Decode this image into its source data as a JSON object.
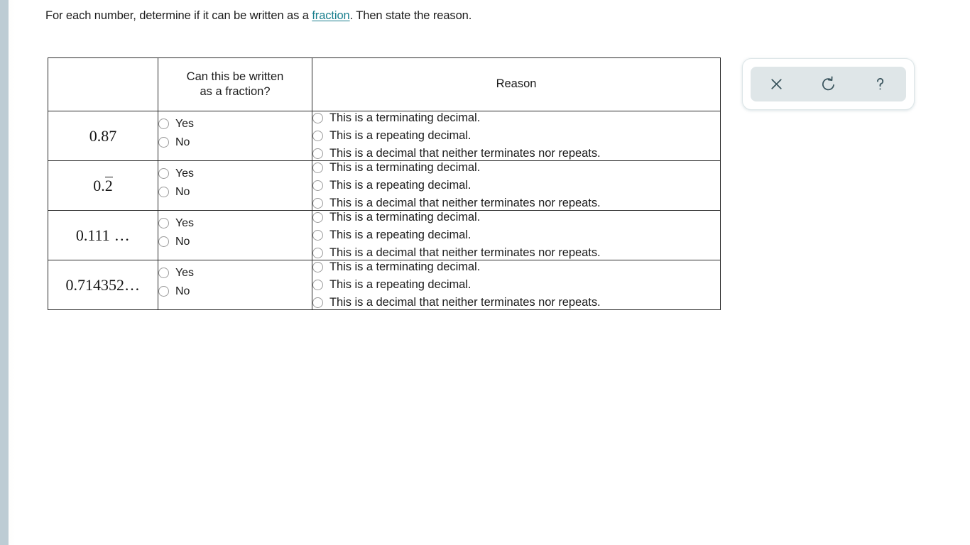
{
  "page": {
    "background_color": "#ffffff",
    "left_strip_color": "#bdccd4",
    "link_color": "#1a7f8e",
    "text_color": "#1c1c1c"
  },
  "prompt": {
    "before_link": "For each number, determine if it can be written as a ",
    "link_text": "fraction",
    "after_link": ". Then state the reason."
  },
  "table": {
    "headers": {
      "number_column": "",
      "fraction_column_line1": "Can this be written",
      "fraction_column_line2": "as a fraction?",
      "reason_column": "Reason"
    },
    "yesno_options": [
      "Yes",
      "No"
    ],
    "reason_options": [
      "This is a terminating decimal.",
      "This is a repeating decimal.",
      "This is a decimal that neither terminates nor repeats."
    ],
    "rows": [
      {
        "number_display": "0.87",
        "number_prefix": "0.87",
        "number_overline": "",
        "number_suffix": "",
        "selected_yesno": null,
        "selected_reason": null
      },
      {
        "number_display": "0.2̅",
        "number_prefix": "0.",
        "number_overline": "2",
        "number_suffix": "",
        "selected_yesno": null,
        "selected_reason": null
      },
      {
        "number_display": "0.111 …",
        "number_prefix": "0.111",
        "number_overline": "",
        "number_suffix": " …",
        "selected_yesno": null,
        "selected_reason": null
      },
      {
        "number_display": "0.714352…",
        "number_prefix": "0.714352",
        "number_overline": "",
        "number_suffix": "…",
        "selected_yesno": null,
        "selected_reason": null
      }
    ]
  },
  "toolbar": {
    "background_color": "#dfe6e8",
    "icon_color": "#3c565f",
    "buttons": [
      {
        "name": "close-icon",
        "label": "×",
        "title": "Close"
      },
      {
        "name": "undo-icon",
        "label": "↺",
        "title": "Reset"
      },
      {
        "name": "help-icon",
        "label": "?",
        "title": "Help"
      }
    ]
  }
}
